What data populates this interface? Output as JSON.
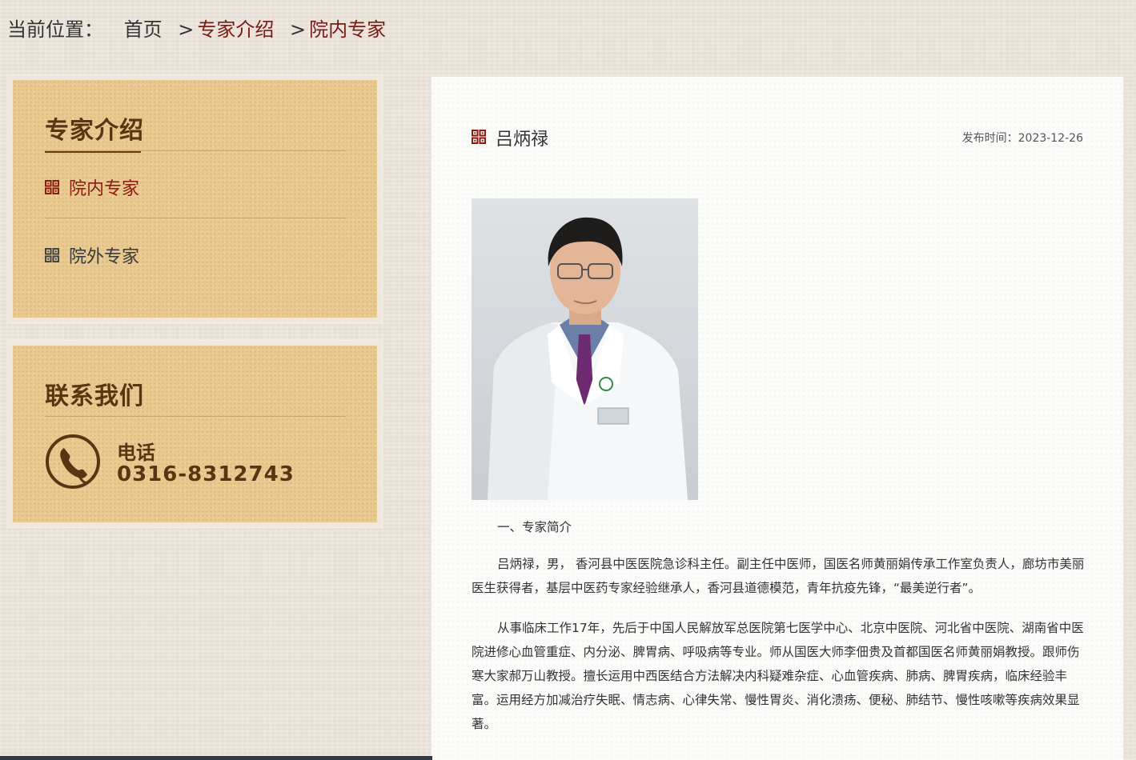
{
  "breadcrumb": {
    "prefix": "当前位置：",
    "home": "首页",
    "separator": ">",
    "level1": "专家介绍",
    "level2": "院内专家"
  },
  "sidebar": {
    "title": "专家介绍",
    "items": [
      {
        "label": "院内专家",
        "active": true
      },
      {
        "label": "院外专家",
        "active": false
      }
    ]
  },
  "contact": {
    "title": "联系我们",
    "phone_label": "电话",
    "phone_number": "0316-8312743"
  },
  "article": {
    "title": "吕炳禄",
    "publish_label": "发布时间：",
    "publish_date": "2023-12-26",
    "section_heading": "一、专家简介",
    "paragraphs": [
      "吕炳禄，男， 香河县中医医院急诊科主任。副主任中医师，国医名师黄丽娟传承工作室负责人，廊坊市美丽医生获得者，基层中医药专家经验继承人，香河县道德模范，青年抗疫先锋，“最美逆行者”。",
      "从事临床工作17年，先后于中国人民解放军总医院第七医学中心、北京中医院、河北省中医院、湖南省中医院进修心血管重症、内分泌、脾胃病、呼吸病等专业。师从国医大师李佃贵及首都国医名师黄丽娟教授。跟师伤寒大家郝万山教授。擅长运用中西医结合方法解决内科疑难杂症、心血管疾病、肺病、脾胃疾病，临床经验丰富。运用经方加减治疗失眠、情志病、心律失常、慢性胃炎、消化溃疡、便秘、肺结节、慢性咳嗽等疾病效果显著。"
    ]
  },
  "colors": {
    "accent": "#8b1c12",
    "panel": "#e8c98f",
    "panel_text": "#5b3512"
  }
}
